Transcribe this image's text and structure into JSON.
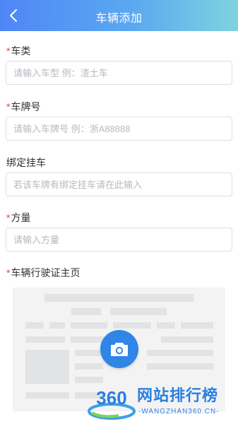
{
  "header": {
    "title": "车辆添加"
  },
  "required_mark": "*",
  "fields": [
    {
      "label": "车类",
      "required": true,
      "placeholder": "请输入车型 例：渣土车"
    },
    {
      "label": "车牌号",
      "required": true,
      "placeholder": "请输入车牌号 例：浙A88888"
    },
    {
      "label": "绑定挂车",
      "required": false,
      "placeholder": "若该车牌有绑定挂车请在此输入"
    },
    {
      "label": "方量",
      "required": true,
      "placeholder": "请输入方量"
    }
  ],
  "license_upload": {
    "label": "车辆行驶证主页",
    "required": true
  },
  "watermark": {
    "logo_text": "360",
    "brand": "网站排行榜",
    "domain": "-WANGZHAN360.CN-"
  },
  "colors": {
    "header_start": "#4f86f7",
    "header_end": "#7fd3df",
    "required": "#e24a3b",
    "camera": "#2f86e6"
  }
}
